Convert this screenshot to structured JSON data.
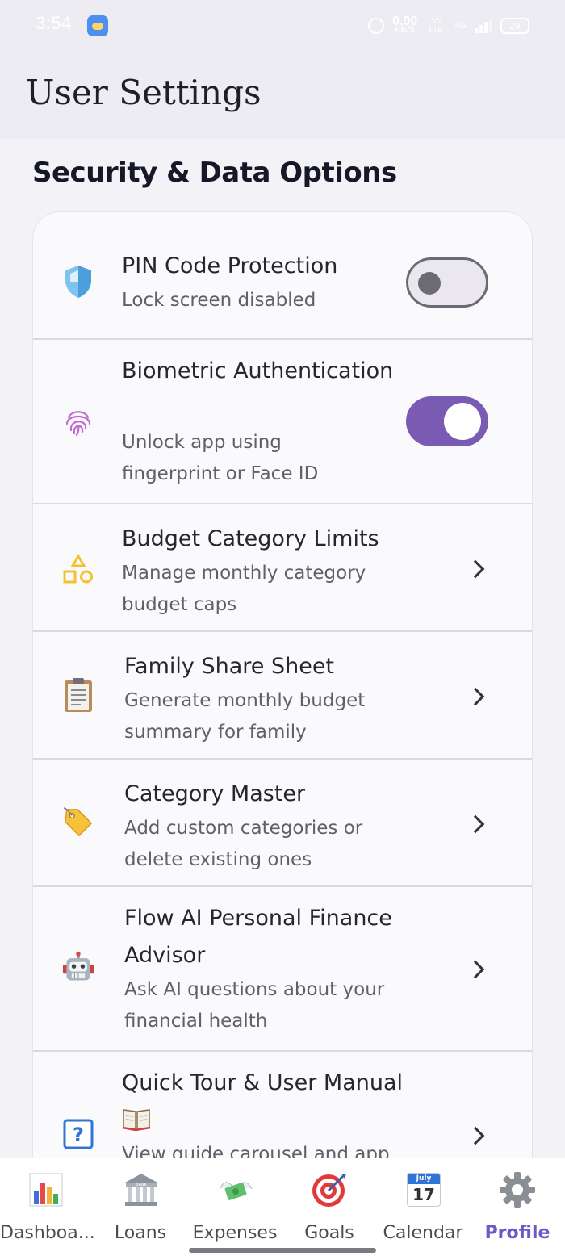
{
  "status_bar": {
    "time": "3:54",
    "net_speed": "0.00",
    "net_unit": "KB/S",
    "volte": "Vo LTE",
    "network": "4G",
    "battery": "29"
  },
  "header": {
    "title": "User Settings"
  },
  "section": {
    "title": "Security & Data Options"
  },
  "settings": [
    {
      "title": "PIN Code Protection",
      "subtitle": "Lock screen disabled",
      "icon": "shield-icon",
      "control": "toggle",
      "enabled": false
    },
    {
      "title": "Biometric Authentication",
      "subtitle": "Unlock app using fingerprint or Face ID",
      "icon": "fingerprint-icon",
      "control": "toggle",
      "enabled": true
    },
    {
      "title": "Budget Category Limits",
      "subtitle": "Manage monthly category budget caps",
      "icon": "shapes-icon",
      "control": "chevron"
    },
    {
      "title": "Family Share Sheet",
      "subtitle": "Generate monthly budget summary for family",
      "icon": "clipboard-icon",
      "control": "chevron"
    },
    {
      "title": "Category Master",
      "subtitle": "Add custom categories or delete existing ones",
      "icon": "tag-icon",
      "control": "chevron"
    },
    {
      "title": "Flow AI Personal Finance Advisor",
      "subtitle": "Ask AI questions about your financial health",
      "icon": "robot-icon",
      "control": "chevron"
    },
    {
      "title": "Quick Tour & User Manual",
      "subtitle": "View guide carousel and app",
      "icon": "help-icon",
      "title_icon": "book-icon",
      "control": "chevron"
    }
  ],
  "nav": [
    {
      "label": "Dashboa...",
      "icon": "bar-chart-icon",
      "active": false
    },
    {
      "label": "Loans",
      "icon": "bank-icon",
      "active": false
    },
    {
      "label": "Expenses",
      "icon": "money-wings-icon",
      "active": false
    },
    {
      "label": "Goals",
      "icon": "target-icon",
      "active": false
    },
    {
      "label": "Calendar",
      "icon": "calendar-icon",
      "calendar_month": "July",
      "calendar_day": "17",
      "active": false
    },
    {
      "label": "Profile",
      "icon": "gear-icon",
      "active": true
    }
  ],
  "colors": {
    "accent": "#7a5bb4",
    "active_nav": "#6f57c9",
    "header_bg": "#ececf2"
  }
}
